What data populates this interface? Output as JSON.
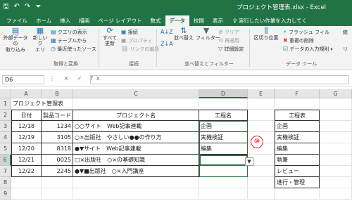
{
  "title_bar": {
    "qat_icons": [
      "save-icon",
      "undo-icon",
      "redo-icon",
      "customize-qat-icon"
    ],
    "window_title": "プロジェクト管理表.xlsx - Excel"
  },
  "tabs": [
    "ファイル",
    "ホーム",
    "挿入",
    "描画",
    "ページ レイアウト",
    "数式",
    "データ",
    "校閲",
    "表示"
  ],
  "active_tab": "データ",
  "tell_me": "♀ 実行したい作業を入力してく",
  "ribbon": {
    "get_transform": {
      "external_data": "外部データの\n取り込み",
      "new_query": "新しいク\nエリ",
      "show_queries": "クエリの表示",
      "from_table": "テーブルから",
      "recent_sources": "最近使ったソース",
      "group": "取得と変換"
    },
    "connections": {
      "refresh_all": "すべて\n更新",
      "connections": "接続",
      "properties": "プロパティ",
      "edit_links": "リンクの編集",
      "group": "接続"
    },
    "sort_filter": {
      "sort_az": "A↓Z",
      "sort_za": "Z↓A",
      "sort": "並べ替え",
      "filter": "フィルター",
      "clear": "クリア",
      "reapply": "再適用",
      "advanced": "詳細設定",
      "group": "並べ替えとフィルター"
    },
    "data_tools": {
      "text_to_columns": "区切り位置",
      "flash_fill": "フラッシュ フィル",
      "remove_duplicates": "重複の削除",
      "data_validation": "データの入力規則",
      "group": "データ ツール",
      "extra_1": "統",
      "extra_2": "リ"
    }
  },
  "formula_bar": {
    "name_box": "D6",
    "buttons": "⋮ × ✓ fx",
    "formula": ""
  },
  "sheet": {
    "columns": [
      "A",
      "B",
      "C",
      "D",
      "E",
      "F",
      "G"
    ],
    "selected_column": "D",
    "rows": [
      "1",
      "2",
      "3",
      "4",
      "5",
      "6",
      "7",
      "8",
      "9"
    ],
    "selected_row": "6",
    "title": "プロジェクト管理表",
    "headers": [
      "日付",
      "製品コード",
      "プロジェクト名",
      "工程名"
    ],
    "records": [
      [
        "12/18",
        "1234",
        "○○サイト　Web記事連載",
        "企画"
      ],
      [
        "12/19",
        "3105",
        "○×出版社　やさしい●●の作り方",
        "実機検証"
      ],
      [
        "12/20",
        "8318",
        "●▼サイト　Web記事連載",
        "編集"
      ],
      [
        "12/21",
        "0025",
        "□×出版社　○×の基礎知識",
        ""
      ],
      [
        "12/22",
        "2245",
        "●▼■出版社　○×入門講座",
        ""
      ]
    ],
    "process_table_header": "工程表",
    "process_list": [
      "企画",
      "実機検証",
      "編集",
      "執筆",
      "レビュー",
      "進行・管理"
    ]
  },
  "annotation": {
    "marker": "⑩",
    "marker_color": "#e2262a"
  },
  "colors": {
    "excel_green": "#217346"
  }
}
